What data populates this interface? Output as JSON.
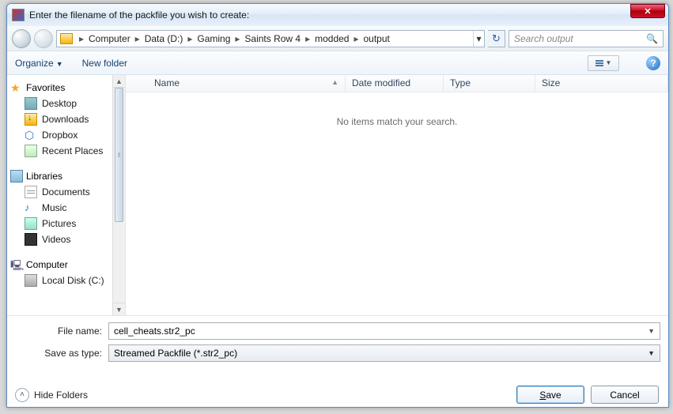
{
  "title": "Enter the filename of the packfile you wish to create:",
  "breadcrumb": [
    "Computer",
    "Data (D:)",
    "Gaming",
    "Saints Row 4",
    "modded",
    "output"
  ],
  "search_placeholder": "Search output",
  "toolbar": {
    "organize": "Organize",
    "newfolder": "New folder"
  },
  "tree": {
    "favorites": {
      "label": "Favorites",
      "items": [
        "Desktop",
        "Downloads",
        "Dropbox",
        "Recent Places"
      ]
    },
    "libraries": {
      "label": "Libraries",
      "items": [
        "Documents",
        "Music",
        "Pictures",
        "Videos"
      ]
    },
    "computer": {
      "label": "Computer",
      "items": [
        "Local Disk (C:)"
      ]
    }
  },
  "columns": {
    "name": "Name",
    "date": "Date modified",
    "type": "Type",
    "size": "Size"
  },
  "empty_msg": "No items match your search.",
  "filename_label": "File name:",
  "filename_value": "cell_cheats.str2_pc",
  "type_label": "Save as type:",
  "type_value": "Streamed Packfile (*.str2_pc)",
  "hide_folders": "Hide Folders",
  "save": "Save",
  "cancel": "Cancel"
}
